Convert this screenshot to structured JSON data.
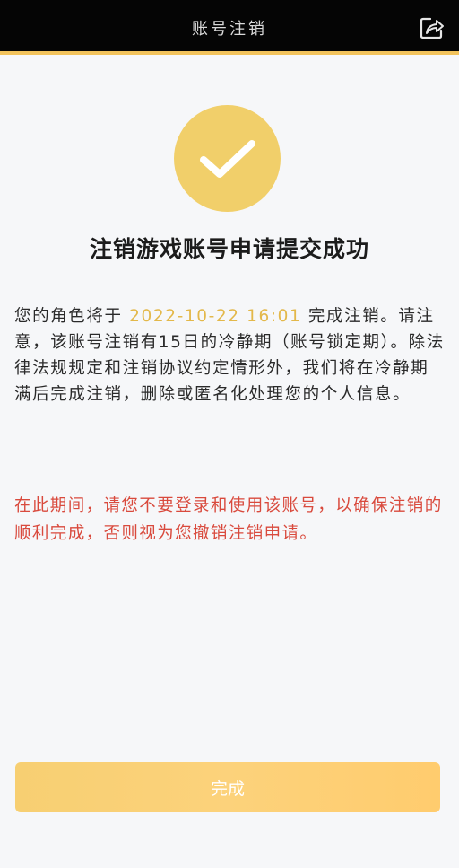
{
  "header": {
    "title": "账号注销",
    "share_icon": "share-icon"
  },
  "colors": {
    "accent": "#f2c35c",
    "success_circle": "#f1cf6a",
    "date_highlight": "#e3b84a",
    "warning_text": "#d94a3d"
  },
  "status": {
    "icon": "checkmark-icon",
    "title": "注销游戏账号申请提交成功"
  },
  "description": {
    "prefix": "您的角色将于 ",
    "date": "2022-10-22 16:01",
    "suffix": " 完成注销。请注意，该账号注销有15日的冷静期（账号锁定期）。除法律法规规定和注销协议约定情形外，我们将在冷静期满后完成注销，删除或匿名化处理您的个人信息。"
  },
  "warning": {
    "text": "在此期间，请您不要登录和使用该账号，以确保注销的顺利完成，否则视为您撤销注销申请。"
  },
  "actions": {
    "done_label": "完成"
  }
}
